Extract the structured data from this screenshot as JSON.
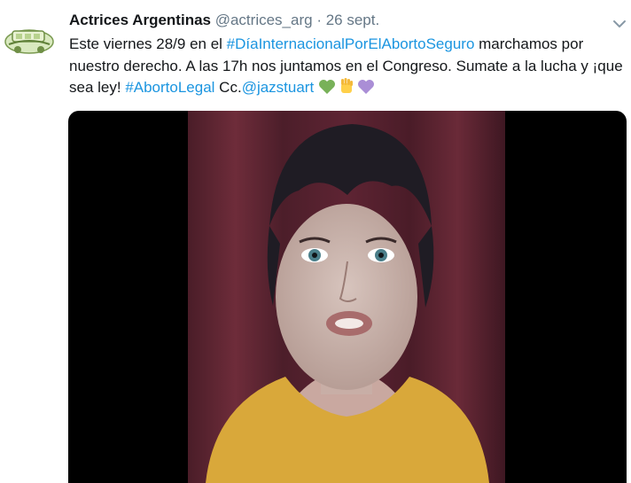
{
  "tweet": {
    "display_name": "Actrices Argentinas",
    "handle": "@actrices_arg",
    "separator": "·",
    "time": "26 sept.",
    "text": {
      "part1": "Este viernes 28/9 en el ",
      "hashtag1": "#DíaInternacionalPorElAbortoSeguro",
      "part2": " marchamos por nuestro derecho. A las 17h nos juntamos en el Congreso. Sumate a la lucha y ¡que sea ley! ",
      "hashtag2": "#AbortoLegal",
      "part3": " Cc.",
      "mention": "@jazstuart"
    },
    "emojis": [
      "green-heart",
      "raised-fist",
      "purple-heart"
    ]
  },
  "colors": {
    "link": "#1b95e0",
    "muted": "#657786",
    "text": "#14171a"
  }
}
